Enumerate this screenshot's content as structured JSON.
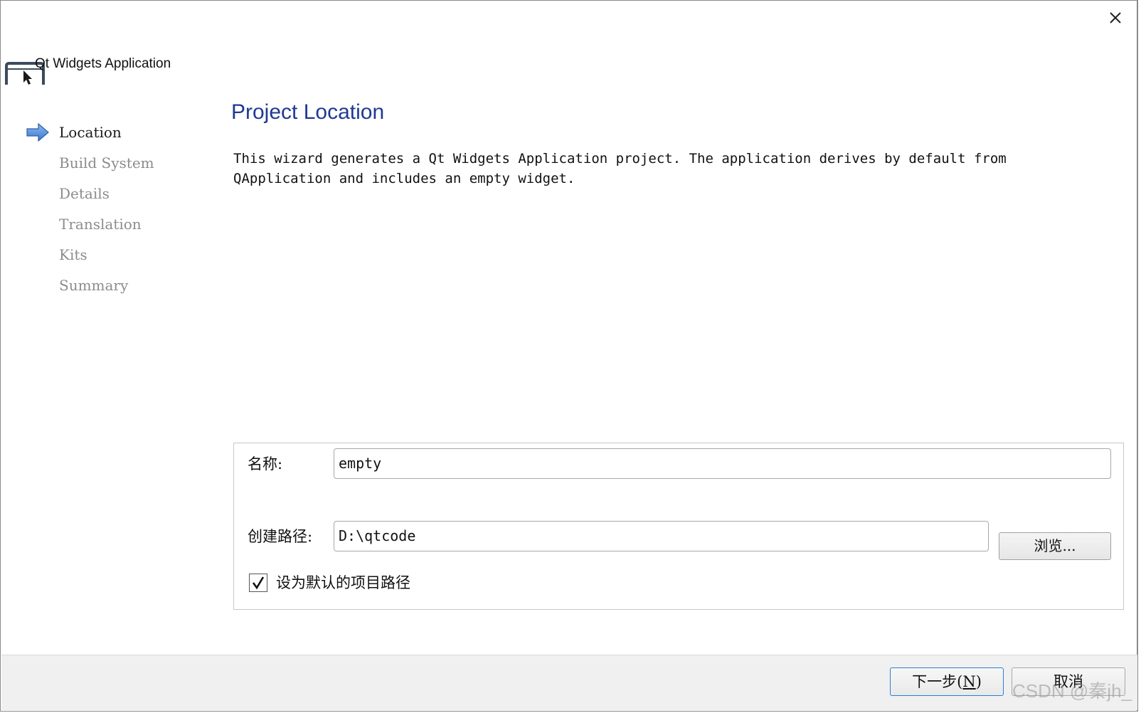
{
  "window": {
    "title": "Qt Widgets Application",
    "close_icon": "close-icon"
  },
  "sidebar": {
    "steps": [
      {
        "label": "Location",
        "active": true
      },
      {
        "label": "Build System",
        "active": false
      },
      {
        "label": "Details",
        "active": false
      },
      {
        "label": "Translation",
        "active": false
      },
      {
        "label": "Kits",
        "active": false
      },
      {
        "label": "Summary",
        "active": false
      }
    ]
  },
  "page": {
    "title": "Project Location",
    "description_line1": "This wizard generates a Qt Widgets Application project. The application derives by default from",
    "description_line2": "QApplication and includes an empty widget."
  },
  "form": {
    "name_label": "名称:",
    "name_value": "empty",
    "path_label": "创建路径:",
    "path_value": "D:\\qtcode",
    "browse_label": "浏览...",
    "default_path_label": "设为默认的项目路径",
    "default_path_checked": true
  },
  "footer": {
    "next_label": "下一步(",
    "next_mnemonic": "N",
    "next_suffix": ")",
    "cancel_label": "取消"
  },
  "watermark": "CSDN @秦jh_",
  "colors": {
    "title_blue": "#1f3a93",
    "inactive_step": "#8c8c8c",
    "focus_border": "#2d7fd4",
    "arrow_blue": "#4a86d8"
  }
}
